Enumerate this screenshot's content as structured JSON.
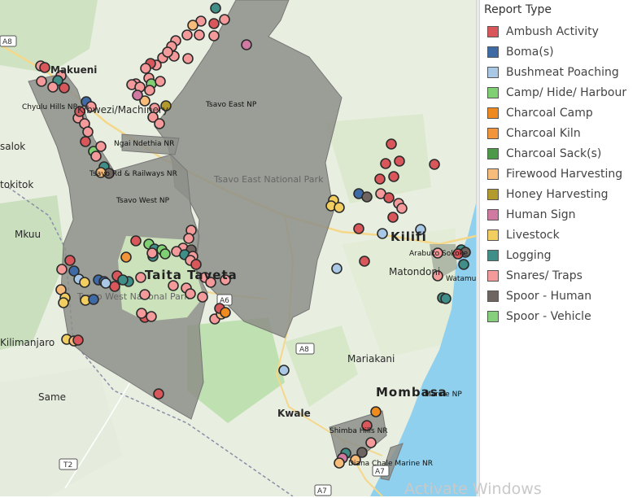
{
  "legend": {
    "title": "Report Type",
    "items": [
      {
        "label": "Ambush Activity",
        "color": "#d9575a"
      },
      {
        "label": "Boma(s)",
        "color": "#3e6aa6"
      },
      {
        "label": "Bushmeat Poaching",
        "color": "#a9c8e6"
      },
      {
        "label": "Camp/ Hide/ Harbour",
        "color": "#7fcf73"
      },
      {
        "label": "Charcoal Camp",
        "color": "#ef8a1e"
      },
      {
        "label": "Charcoal Kiln",
        "color": "#f2953a"
      },
      {
        "label": "Charcoal Sack(s)",
        "color": "#4c9a48"
      },
      {
        "label": "Firewood Harvesting",
        "color": "#f7bb7a"
      },
      {
        "label": "Honey Harvesting",
        "color": "#b39a2c"
      },
      {
        "label": "Human Sign",
        "color": "#d07aa1"
      },
      {
        "label": "Livestock",
        "color": "#f2ce61"
      },
      {
        "label": "Logging",
        "color": "#3f8f88"
      },
      {
        "label": "Snares/ Traps",
        "color": "#f59a9a"
      },
      {
        "label": "Spoor - Human",
        "color": "#6e6561"
      },
      {
        "label": "Spoor - Vehicle",
        "color": "#86d07d"
      }
    ]
  },
  "map": {
    "place_labels": [
      "Makueni",
      "Chyulu Hills NP",
      "Kibwezi/Machinery",
      "Tsavo East NP",
      "Ngai Ndethia NR",
      "Tsavo Rd & Railways NR",
      "Tsavo East National Park",
      "Tsavo West NP",
      "Mkuu",
      "Taita Taveta",
      "Tsavo West National Park",
      "Kilimanjaro",
      "Same",
      "Kilifi",
      "Arabuko Sokoke",
      "Watamu",
      "Matondoni",
      "Mariakani",
      "Mombasa",
      "Marine NP",
      "Kwale",
      "Shimba Hills NR",
      "Diana Chale Marine NR",
      "salok",
      "tokitok"
    ],
    "road_labels": [
      "A8",
      "A6",
      "A8",
      "T2",
      "A7",
      "A7"
    ]
  },
  "watermark": "Activate Windows"
}
